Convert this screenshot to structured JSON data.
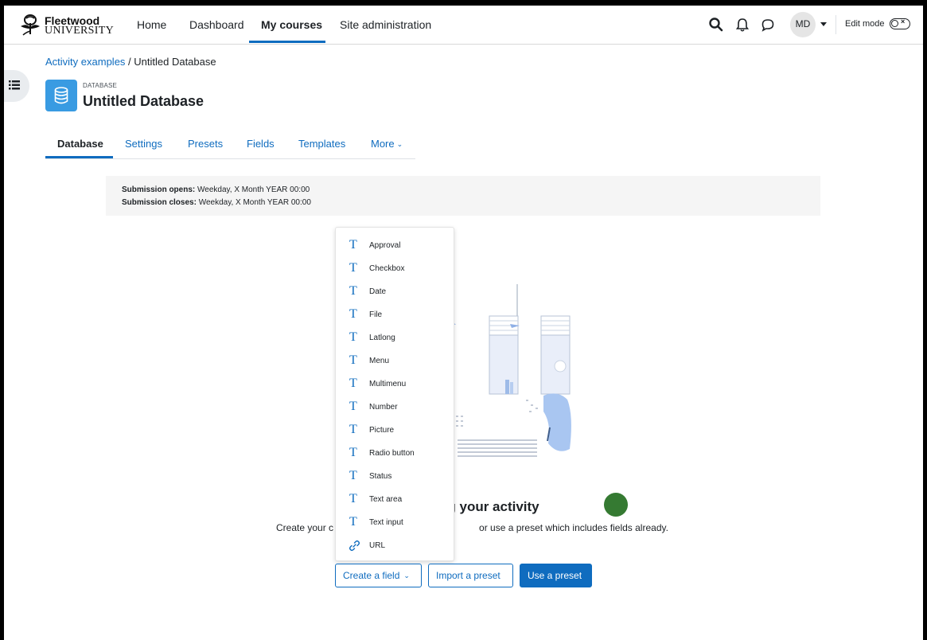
{
  "brand": {
    "name_line1": "Fleetwood",
    "name_line2": "UNIVERSITY"
  },
  "nav": {
    "items": [
      {
        "label": "Home"
      },
      {
        "label": "Dashboard"
      },
      {
        "label": "My courses"
      },
      {
        "label": "Site administration"
      }
    ],
    "active": "My courses",
    "avatar_initials": "MD",
    "edit_mode_label": "Edit mode",
    "edit_mode_on": false
  },
  "breadcrumb": {
    "parent": "Activity examples",
    "separator": " / ",
    "current": "Untitled Database"
  },
  "module": {
    "kind": "DATABASE",
    "title": "Untitled Database",
    "icon": "database-icon",
    "icon_color": "#399be2"
  },
  "tabs": [
    {
      "label": "Database"
    },
    {
      "label": "Settings"
    },
    {
      "label": "Presets"
    },
    {
      "label": "Fields"
    },
    {
      "label": "Templates"
    },
    {
      "label": "More"
    }
  ],
  "dates": {
    "opens_label": "Submission opens:",
    "opens_value": "Weekday, X Month YEAR 00:00",
    "closes_label": "Submission closes:",
    "closes_value": "Weekday, X Month YEAR 00:00"
  },
  "empty_state": {
    "headline": "ng your activity",
    "subline_left": "Create your c",
    "subline_right": "or use a preset which includes fields already."
  },
  "field_menu": {
    "items": [
      {
        "label": "Approval",
        "icon": "text-t-icon"
      },
      {
        "label": "Checkbox",
        "icon": "text-t-icon"
      },
      {
        "label": "Date",
        "icon": "text-t-icon"
      },
      {
        "label": "File",
        "icon": "text-t-icon"
      },
      {
        "label": "Latlong",
        "icon": "text-t-icon"
      },
      {
        "label": "Menu",
        "icon": "text-t-icon"
      },
      {
        "label": "Multimenu",
        "icon": "text-t-icon"
      },
      {
        "label": "Number",
        "icon": "text-t-icon"
      },
      {
        "label": "Picture",
        "icon": "text-t-icon"
      },
      {
        "label": "Radio button",
        "icon": "text-t-icon"
      },
      {
        "label": "Status",
        "icon": "text-t-icon"
      },
      {
        "label": "Text area",
        "icon": "text-t-icon"
      },
      {
        "label": "Text input",
        "icon": "text-t-icon"
      },
      {
        "label": "URL",
        "icon": "link-icon"
      }
    ]
  },
  "actions": {
    "create_field": "Create a field",
    "import_preset": "Import a preset",
    "use_preset": "Use a preset"
  },
  "colors": {
    "primary": "#0f6cbf",
    "green_dot": "#357a32"
  }
}
